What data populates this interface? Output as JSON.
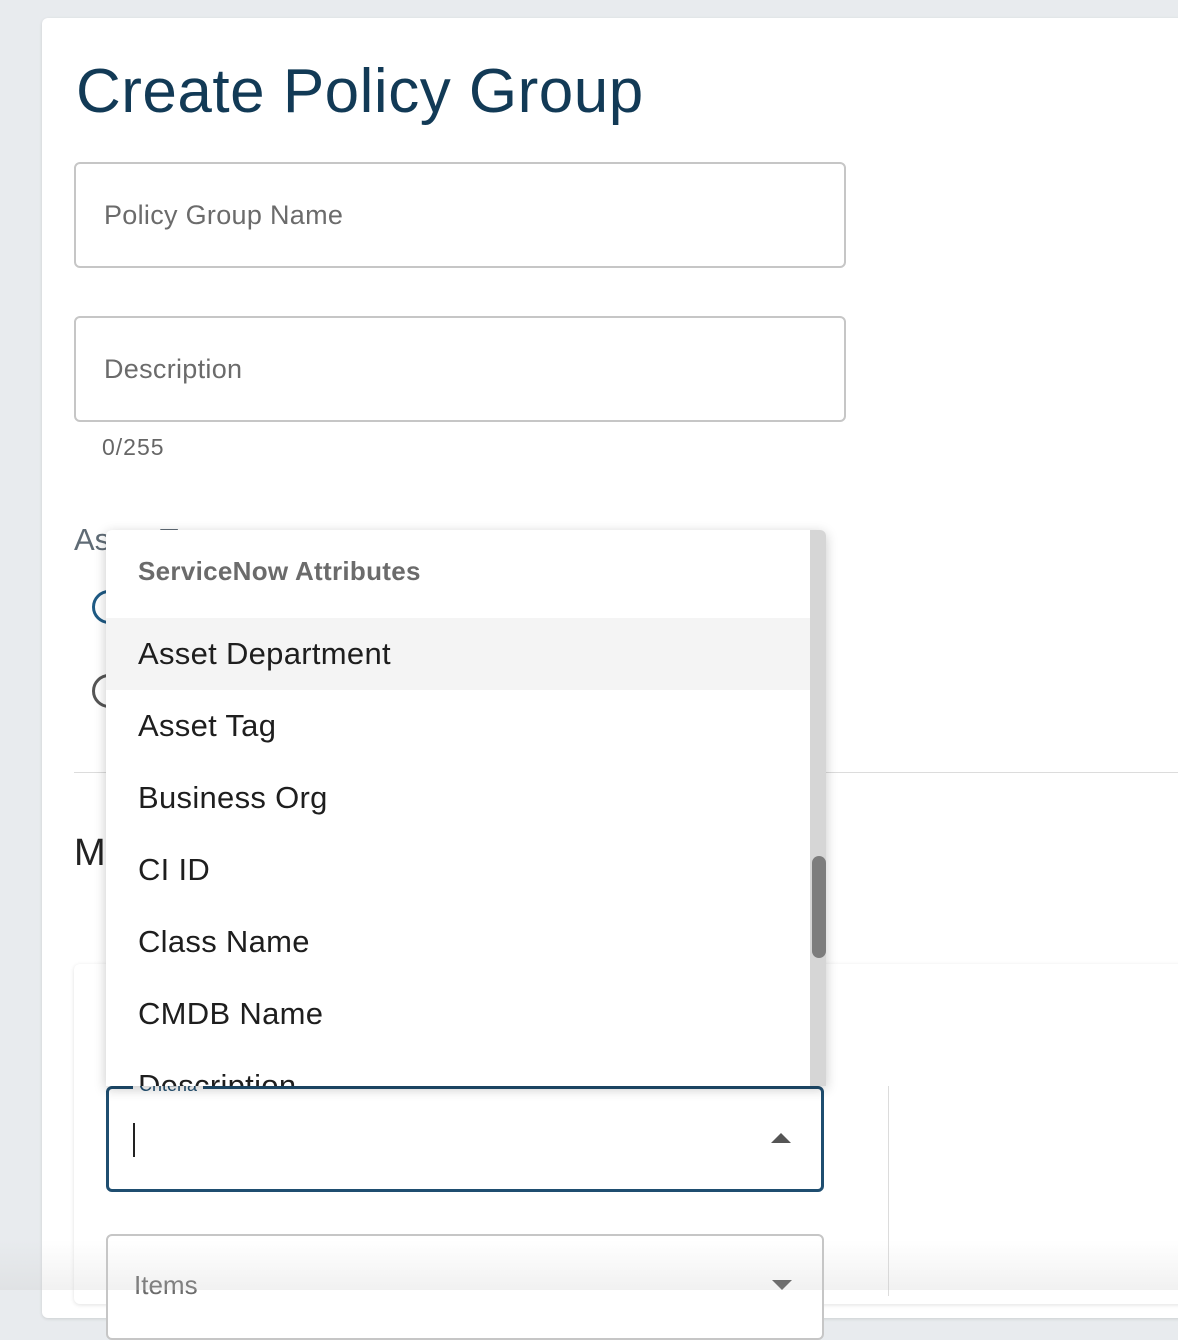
{
  "page": {
    "title": "Create Policy Group"
  },
  "form": {
    "name_placeholder": "Policy Group Name",
    "description_placeholder": "Description",
    "description_counter": "0/255",
    "asset_type_label": "Asset Type",
    "criteria_label": "Criteria",
    "items_placeholder": "Items"
  },
  "section": {
    "heading": "M"
  },
  "dropdown": {
    "header": "ServiceNow Attributes",
    "items": [
      "Asset Department",
      "Asset Tag",
      "Business Org",
      "CI ID",
      "Class Name",
      "CMDB Name",
      "Description"
    ],
    "highlighted_index": 0
  },
  "colors": {
    "title": "#123a56",
    "accent": "#1f4e70",
    "background": "#e8ebee"
  }
}
